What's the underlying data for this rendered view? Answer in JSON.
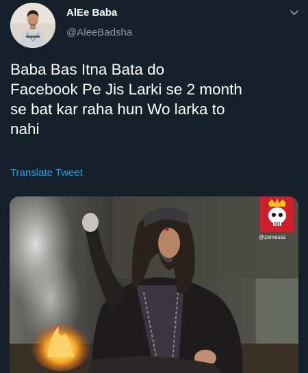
{
  "author": {
    "display_name": "AlEe Baba",
    "handle": "@AleeBadsha"
  },
  "tweet": {
    "lines": [
      "Baba Bas Itna Bata do",
      "Facebook Pe Jis Larki se 2 month",
      "se bat kar raha hun Wo larka to",
      "nahi"
    ],
    "translate_label": "Translate Tweet"
  },
  "media": {
    "watermark": "@zerxesss"
  },
  "icons": {
    "menu": "chevron-down-icon",
    "watermark_logo": "skull-crown-icon"
  },
  "colors": {
    "background": "#15202b",
    "text": "#ffffff",
    "secondary": "#8899a6",
    "link": "#1da1f2"
  }
}
